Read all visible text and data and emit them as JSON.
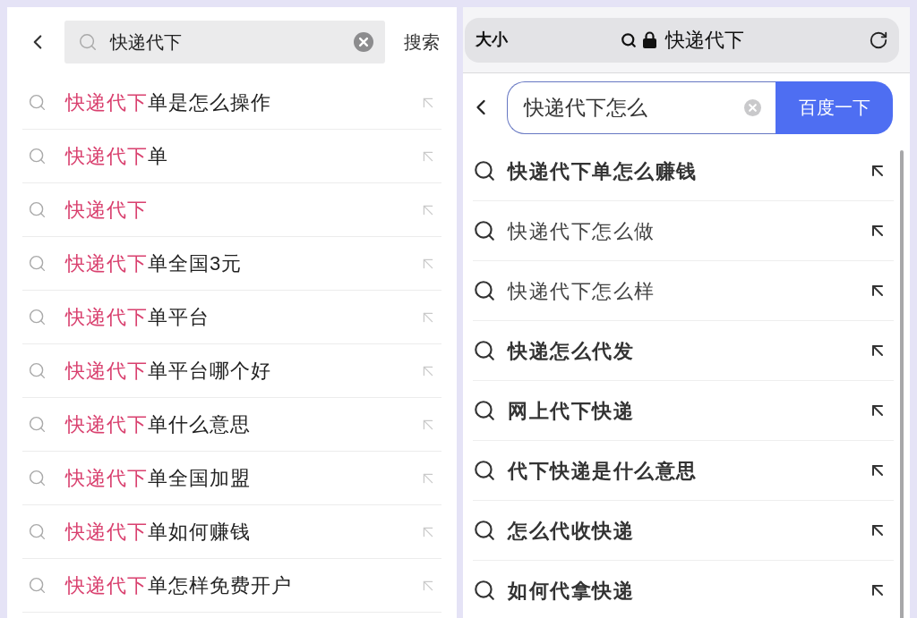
{
  "left": {
    "search_field": {
      "value": "快递代下"
    },
    "search_button": "搜索",
    "suggestions": [
      {
        "match": "快递代下",
        "rest": "单是怎么操作"
      },
      {
        "match": "快递代下",
        "rest": "单"
      },
      {
        "match": "快递代下"
      },
      {
        "match": "快递代下",
        "rest": "单全国3元"
      },
      {
        "match": "快递代下",
        "rest": "单平台"
      },
      {
        "match": "快递代下",
        "rest": "单平台哪个好"
      },
      {
        "match": "快递代下",
        "rest": "单什么意思"
      },
      {
        "match": "快递代下",
        "rest": "单全国加盟"
      },
      {
        "match": "快递代下",
        "rest": "单如何赚钱"
      },
      {
        "match": "快递代下",
        "rest": "单怎样免费开户"
      }
    ]
  },
  "right": {
    "browser_bar": {
      "text_size_button": "大小",
      "address": "快递代下"
    },
    "search_field": {
      "value": "快递代下怎么"
    },
    "search_button": "百度一下",
    "suggestions": [
      {
        "text": "快递代下单怎么赚钱",
        "emphasized": true
      },
      {
        "text": "快递代下怎么做",
        "emphasized": false
      },
      {
        "text": "快递代下怎么样",
        "emphasized": false
      },
      {
        "text": "快递怎么代发",
        "emphasized": true
      },
      {
        "text": "网上代下快递",
        "emphasized": true
      },
      {
        "text": "代下快递是什么意思",
        "emphasized": true
      },
      {
        "text": "怎么代收快递",
        "emphasized": true
      },
      {
        "text": "如何代拿快递",
        "emphasized": true
      }
    ]
  }
}
